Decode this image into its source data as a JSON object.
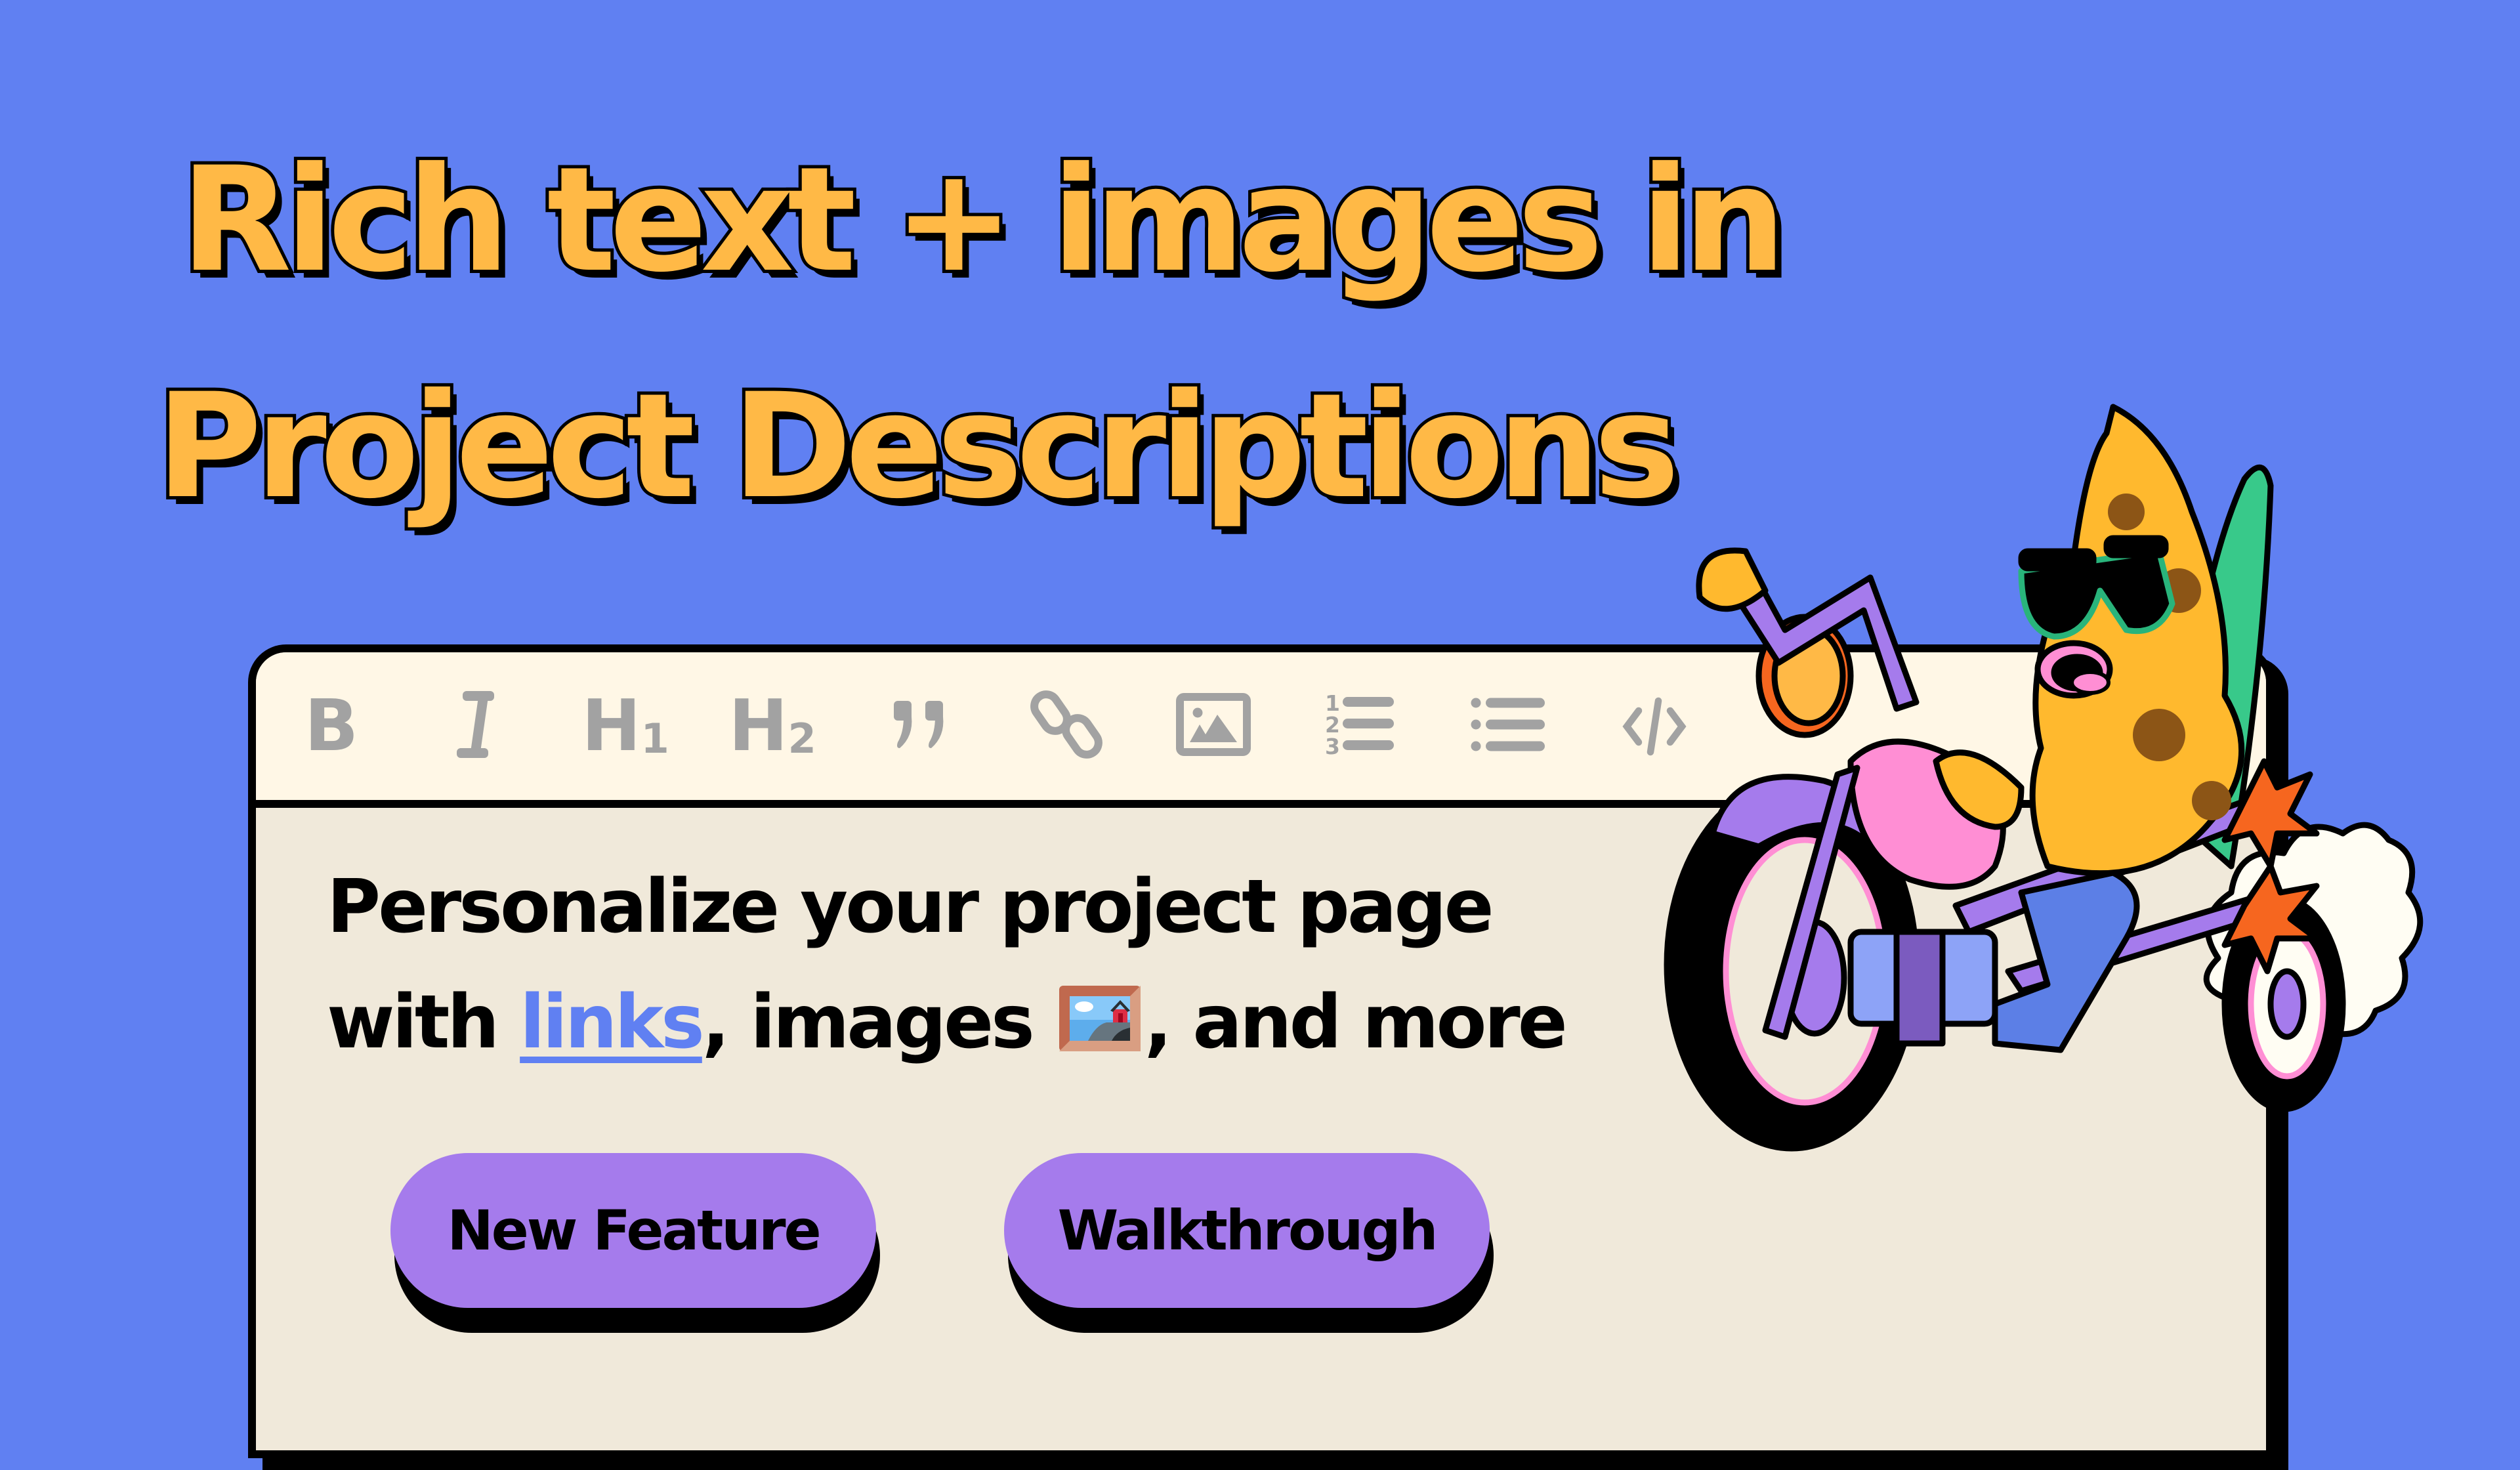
{
  "headline": {
    "line1": "Rich text + images in",
    "line2": "Project Descriptions"
  },
  "editor": {
    "toolbar": [
      {
        "name": "bold",
        "label": "B",
        "icon": "bold-icon"
      },
      {
        "name": "italic",
        "label": "I",
        "icon": "italic-icon"
      },
      {
        "name": "heading-1",
        "label": "H",
        "sub": "1",
        "icon": "heading-1-icon"
      },
      {
        "name": "heading-2",
        "label": "H",
        "sub": "2",
        "icon": "heading-2-icon"
      },
      {
        "name": "blockquote",
        "label": "”",
        "icon": "quote-icon"
      },
      {
        "name": "link",
        "icon": "link-icon"
      },
      {
        "name": "image",
        "icon": "image-icon"
      },
      {
        "name": "ordered-list",
        "icon": "ordered-list-icon"
      },
      {
        "name": "bullet-list",
        "icon": "bullet-list-icon"
      },
      {
        "name": "code",
        "icon": "code-icon"
      }
    ],
    "content": {
      "line1": "Personalize your project page",
      "line2_prefix": "with ",
      "link_text": "links",
      "line2_mid": ", images ",
      "emoji": "framed-picture",
      "line2_suffix": ", and more"
    },
    "buttons": {
      "new_feature": "New Feature",
      "walkthrough": "Walkthrough"
    }
  },
  "colors": {
    "background": "#6080F2",
    "headline": "#FFB946",
    "toolbar_bg": "#FFF7E6",
    "editor_bg": "#F0E9DA",
    "toolbar_icon": "#A2A2A2",
    "link": "#6080F2",
    "button": "#A57BEC"
  },
  "illustration": {
    "subject": "banana-character-riding-motorcycle"
  }
}
